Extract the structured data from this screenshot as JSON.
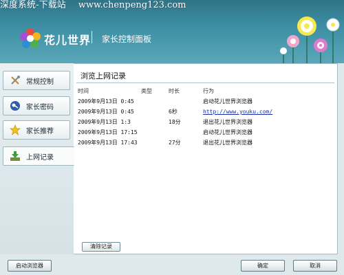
{
  "watermark": {
    "left": "深度系统-下载站",
    "site": "www.chenpeng123.com"
  },
  "header": {
    "title": "花儿世界",
    "subtitle": "家长控制面板"
  },
  "sidebar": {
    "items": [
      {
        "label": "常规控制",
        "icon": "tools-icon"
      },
      {
        "label": "家长密码",
        "icon": "key-icon"
      },
      {
        "label": "家长推荐",
        "icon": "star-icon"
      },
      {
        "label": "上网记录",
        "icon": "download-icon",
        "active": true
      }
    ]
  },
  "main": {
    "title": "浏览上网记录",
    "columns": [
      "时间",
      "类型",
      "时长",
      "行为"
    ],
    "rows": [
      {
        "time": "2009年9月13日 0:45",
        "type": "",
        "duration": "",
        "action": "启动花儿世界浏览器"
      },
      {
        "time": "2009年9月13日 0:45",
        "type": "",
        "duration": "6秒",
        "action": "http://www.youku.com/"
      },
      {
        "time": "2009年9月13日 1:3",
        "type": "",
        "duration": "18分",
        "action": "退出花儿世界浏览器"
      },
      {
        "time": "2009年9月13日 17:15",
        "type": "",
        "duration": "",
        "action": "启动花儿世界浏览器"
      },
      {
        "time": "2009年9月13日 17:43",
        "type": "",
        "duration": "27分",
        "action": "退出花儿世界浏览器"
      }
    ],
    "clear_label": "清除记录"
  },
  "footer": {
    "launch_label": "启动浏览器",
    "ok_label": "确定",
    "cancel_label": "取消"
  },
  "colors": {
    "header": "#3d8ea3",
    "link": "#1a2fa8",
    "sidebar_bg": "#e8f0f2"
  }
}
